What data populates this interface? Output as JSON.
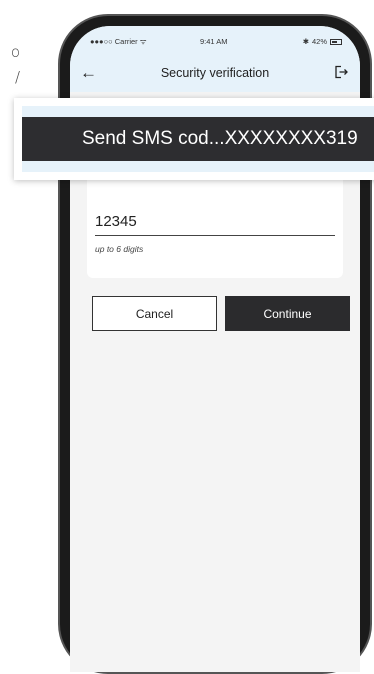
{
  "background_text": [
    "o",
    "/"
  ],
  "status_bar": {
    "carrier": "●●●○○ Carrier ᯤ",
    "time": "9:41 AM",
    "bluetooth": "✱",
    "battery": "42%"
  },
  "header": {
    "title": "Security verification",
    "back_icon": "arrow-left-icon",
    "logout_icon": "logout-icon"
  },
  "form": {
    "code_value": "12345",
    "hint": "up to 6 digits"
  },
  "buttons": {
    "cancel": "Cancel",
    "continue": "Continue"
  },
  "toast": {
    "message": "Send SMS cod...XXXXXXXX319"
  },
  "colors": {
    "header_bg": "#e6f2fa",
    "toast_bg": "#2d2d30",
    "continue_bg": "#2b2b2d",
    "screen_bg": "#f4f4f4"
  }
}
